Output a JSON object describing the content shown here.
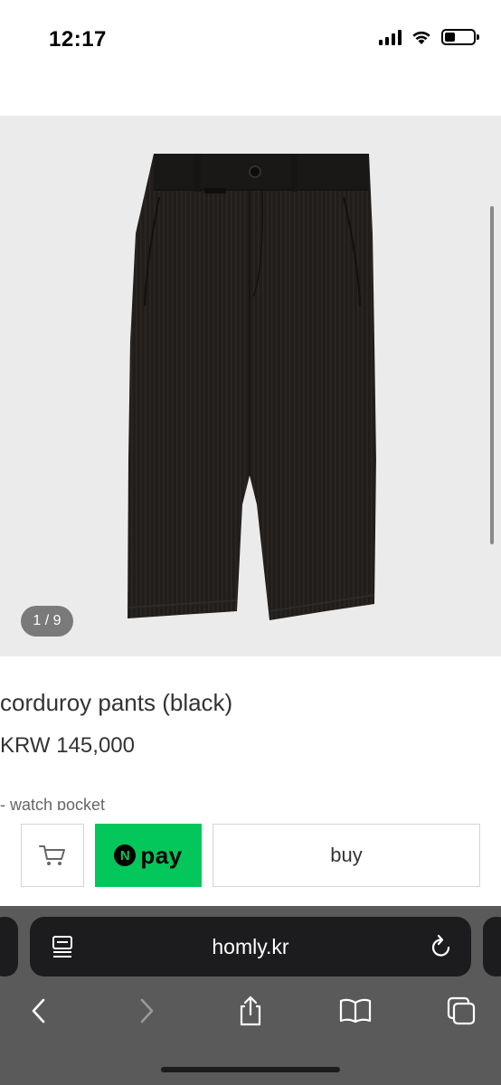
{
  "status_bar": {
    "time": "12:17",
    "icons": [
      "cellular-signal-icon",
      "wifi-icon",
      "battery-icon"
    ],
    "battery_level_percent": 35
  },
  "gallery": {
    "counter": "1 / 9",
    "image": "black-corduroy-pants",
    "background_color": "#ebebeb"
  },
  "product": {
    "title": "corduroy pants (black)",
    "price": "KRW 145,000",
    "description_first_line": "- watch pocket"
  },
  "purchase_bar": {
    "cart_icon": "cart-icon",
    "npay_logo_letter": "N",
    "npay_label": "pay",
    "npay_color": "#03c75a",
    "buy_label": "buy"
  },
  "browser": {
    "address": "homly.kr",
    "page_menu_icon": "page-menu-icon",
    "reload_icon": "reload-icon",
    "toolbar": [
      "back-icon",
      "forward-icon",
      "share-icon",
      "bookmarks-icon",
      "tabs-icon"
    ]
  }
}
